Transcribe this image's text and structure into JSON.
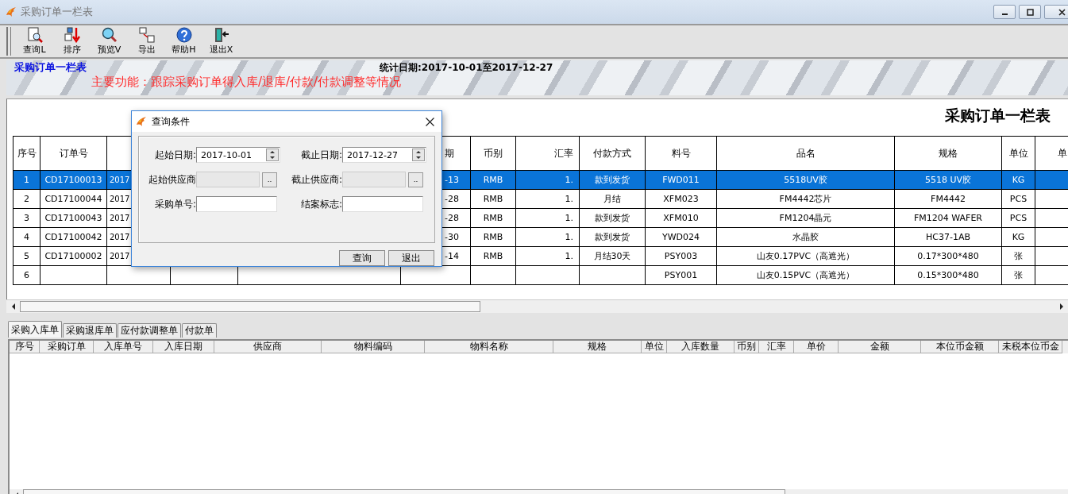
{
  "window": {
    "title": "采购订单一栏表"
  },
  "toolbar": [
    {
      "kind": "query",
      "label": "查询L"
    },
    {
      "kind": "sort",
      "label": "排序"
    },
    {
      "kind": "preview",
      "label": "预览V"
    },
    {
      "kind": "export",
      "label": "导出"
    },
    {
      "kind": "help",
      "label": "帮助H"
    },
    {
      "kind": "exit",
      "label": "退出X"
    }
  ],
  "banner": {
    "title": "采购订单一栏表",
    "date_range": "统计日期:2017-10-01至2017-12-27",
    "description": "主要功能：跟踪采购订单得入库/退库/付款/付款调整等情况"
  },
  "report": {
    "heading": "采购订单一栏表",
    "columns": [
      {
        "label": "序号"
      },
      {
        "label": "订单号"
      },
      {},
      {},
      {},
      {
        "label": "期"
      },
      {
        "label": "币别"
      },
      {
        "label": "汇率"
      },
      {
        "label": "付款方式"
      },
      {
        "label": "料号"
      },
      {
        "label": "品名"
      },
      {
        "label": "规格"
      },
      {
        "label": "单位"
      },
      {
        "label": "单"
      }
    ],
    "rows": [
      {
        "selected": true,
        "cells": [
          "1",
          "CD17100013",
          "2017",
          null,
          null,
          "-13",
          "RMB",
          "1.",
          "款到发货",
          "FWD011",
          "5518UV胶",
          "5518 UV胶",
          "KG",
          null
        ]
      },
      {
        "selected": false,
        "cells": [
          "2",
          "CD17100044",
          "2017",
          null,
          null,
          "-28",
          "RMB",
          "1.",
          "月结",
          "XFM023",
          "FM4442芯片",
          "FM4442",
          "PCS",
          null
        ]
      },
      {
        "selected": false,
        "cells": [
          "3",
          "CD17100043",
          "2017",
          null,
          null,
          "-28",
          "RMB",
          "1.",
          "款到发货",
          "XFM010",
          "FM1204晶元",
          "FM1204 WAFER",
          "PCS",
          null
        ]
      },
      {
        "selected": false,
        "cells": [
          "4",
          "CD17100042",
          "2017",
          null,
          null,
          "-30",
          "RMB",
          "1.",
          "款到发货",
          "YWD024",
          "水晶胶",
          "HC37-1AB",
          "KG",
          null
        ]
      },
      {
        "selected": false,
        "cells": [
          "5",
          "CD17100002",
          "2017",
          null,
          null,
          "-14",
          "RMB",
          "1.",
          "月结30天",
          "PSY003",
          "山友0.17PVC（高遮光）",
          "0.17*300*480",
          "张",
          null
        ]
      },
      {
        "selected": false,
        "cells": [
          "6",
          null,
          null,
          null,
          null,
          null,
          null,
          null,
          null,
          "PSY001",
          "山友0.15PVC（高遮光）",
          "0.15*300*480",
          "张",
          null
        ]
      }
    ]
  },
  "tabs": [
    {
      "label": "采购入库单",
      "selected": true
    },
    {
      "label": "采购退库单",
      "selected": false
    },
    {
      "label": "应付款调整单",
      "selected": false
    },
    {
      "label": "付款单",
      "selected": false
    }
  ],
  "detail_grid": {
    "columns": [
      "序号",
      "采购订单",
      "入库单号",
      "入库日期",
      "供应商",
      "物料编码",
      "物料名称",
      "规格",
      "单位",
      "入库数量",
      "币别",
      "汇率",
      "单价",
      "金额",
      "本位币金额",
      "未税本位币金"
    ]
  },
  "dialog": {
    "title": "查询条件",
    "fields": [
      {
        "kind": "date",
        "label": "起始日期:",
        "value": "2017-10-01",
        "disabled": false
      },
      {
        "kind": "date",
        "label": "截止日期:",
        "value": "2017-12-27",
        "disabled": false
      },
      {
        "kind": "lookup",
        "label": "起始供应商",
        "button": "..",
        "disabled": true
      },
      {
        "kind": "lookup",
        "label": "截止供应商:",
        "button": "..",
        "disabled": true
      },
      {
        "kind": "text",
        "label": "采购单号:",
        "disabled": false
      },
      {
        "kind": "text",
        "label": "结案标志:",
        "disabled": false
      }
    ],
    "buttons": [
      "查询",
      "退出"
    ]
  }
}
